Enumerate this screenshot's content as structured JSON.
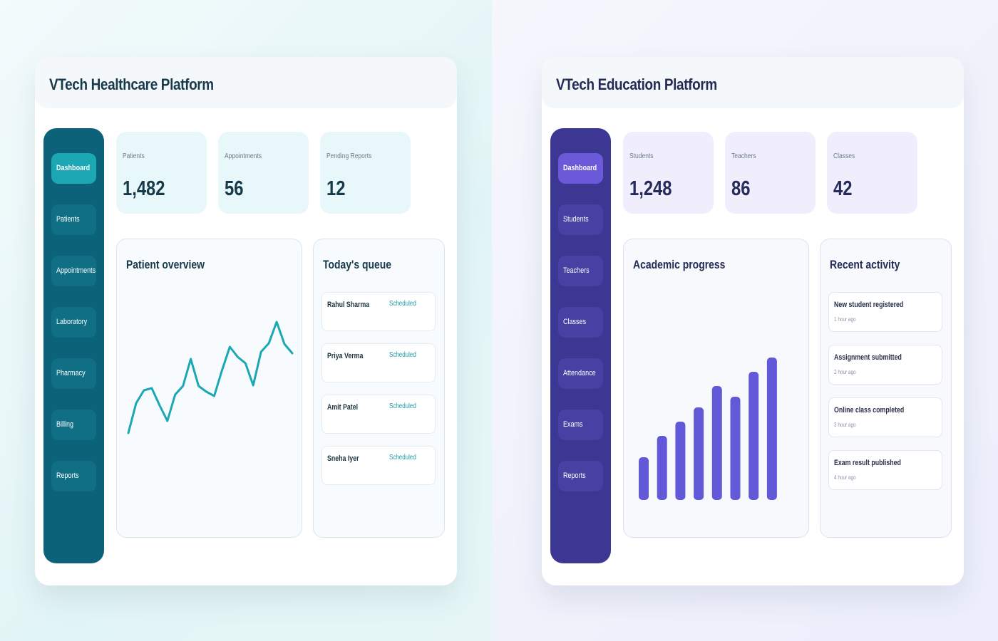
{
  "healthcare": {
    "title": "VTech Healthcare Platform",
    "accent_color": "#1ba7b4",
    "sidebar_color": "#0c6379",
    "nav": [
      "Dashboard",
      "Patients",
      "Appointments",
      "Laboratory",
      "Pharmacy",
      "Billing",
      "Reports"
    ],
    "active_nav": "Dashboard",
    "stats": [
      {
        "label": "Patients",
        "value": "1,482"
      },
      {
        "label": "Appointments",
        "value": "56"
      },
      {
        "label": "Pending Reports",
        "value": "12"
      }
    ],
    "overview_title": "Patient overview",
    "queue_title": "Today's queue",
    "queue": [
      {
        "name": "Rahul Sharma",
        "status": "Scheduled"
      },
      {
        "name": "Priya Verma",
        "status": "Scheduled"
      },
      {
        "name": "Amit Patel",
        "status": "Scheduled"
      },
      {
        "name": "Sneha Iyer",
        "status": "Scheduled"
      }
    ]
  },
  "education": {
    "title": "VTech Education Platform",
    "accent_color": "#6259d8",
    "sidebar_color": "#3c3793",
    "nav": [
      "Dashboard",
      "Students",
      "Teachers",
      "Classes",
      "Attendance",
      "Exams",
      "Reports"
    ],
    "active_nav": "Dashboard",
    "stats": [
      {
        "label": "Students",
        "value": "1,248"
      },
      {
        "label": "Teachers",
        "value": "86"
      },
      {
        "label": "Classes",
        "value": "42"
      }
    ],
    "progress_title": "Academic progress",
    "activity_title": "Recent activity",
    "activity": [
      {
        "text": "New student registered",
        "time": "1 hour ago"
      },
      {
        "text": "Assignment submitted",
        "time": "2 hour ago"
      },
      {
        "text": "Online class completed",
        "time": "3 hour ago"
      },
      {
        "text": "Exam result published",
        "time": "4 hour ago"
      }
    ]
  },
  "chart_data": [
    {
      "type": "line",
      "title": "Patient overview",
      "x": [
        1,
        2,
        3,
        4,
        5,
        6,
        7,
        8,
        9,
        10,
        11,
        12,
        13,
        14,
        15,
        16,
        17,
        18,
        19,
        20,
        21
      ],
      "values": [
        10,
        52,
        70,
        73,
        49,
        27,
        64,
        76,
        114,
        76,
        68,
        62,
        98,
        131,
        117,
        108,
        77,
        124,
        136,
        166,
        135,
        122
      ],
      "color": "#1ba7b4",
      "grid": false
    },
    {
      "type": "bar",
      "title": "Academic progress",
      "categories": [
        "1",
        "2",
        "3",
        "4",
        "5",
        "6",
        "7",
        "8"
      ],
      "values": [
        60,
        90,
        110,
        130,
        160,
        145,
        180,
        200
      ],
      "color": "#6259d8",
      "grid": false
    }
  ]
}
